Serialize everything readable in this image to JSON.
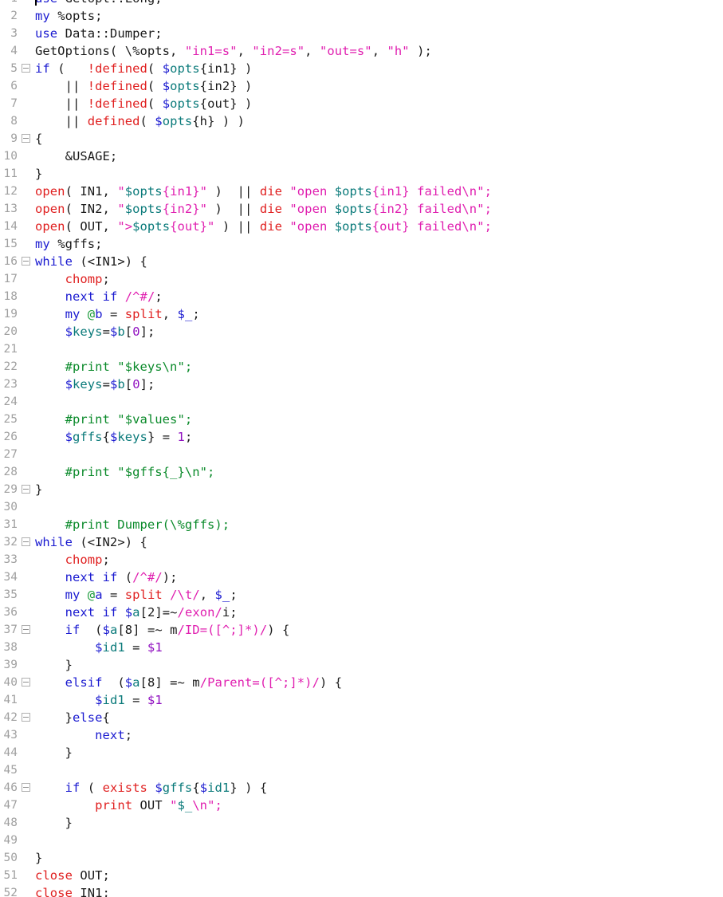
{
  "editor": {
    "language": "perl",
    "gutter_color": "#a0a0a0",
    "background": "#ffffff",
    "foreground": "#1a1a1a",
    "caret_line": 1,
    "caret_column": 1,
    "first_visible_line": 1,
    "last_visible_line": 52,
    "palette": {
      "keyword": "#1a1aD0",
      "function": "#E02020",
      "string": "#E020B0",
      "variable": "#0a7a7a",
      "sigil_scalar": "#1a1aD0",
      "sigil_array": "#1a9a3a",
      "comment": "#0a8a2a",
      "number": "#9010C0",
      "regex": "#E020B0",
      "plain": "#1a1a1a",
      "line_number": "#a0a0a0",
      "fold_marker_border": "#b0b0b0"
    }
  },
  "lines": [
    {
      "n": "1",
      "fold": false,
      "caret": true,
      "tokens": [
        {
          "t": "use",
          "c": "t-kw"
        },
        {
          "t": " Getopt::Long;",
          "c": "t-plain"
        }
      ]
    },
    {
      "n": "2",
      "fold": false,
      "tokens": [
        {
          "t": "my",
          "c": "t-kw"
        },
        {
          "t": " %opts;",
          "c": "t-plain"
        }
      ]
    },
    {
      "n": "3",
      "fold": false,
      "tokens": [
        {
          "t": "use",
          "c": "t-kw"
        },
        {
          "t": " Data::Dumper;",
          "c": "t-plain"
        }
      ]
    },
    {
      "n": "4",
      "fold": false,
      "tokens": [
        {
          "t": "GetOptions( \\%opts, ",
          "c": "t-plain"
        },
        {
          "t": "\"in1=s\"",
          "c": "t-str"
        },
        {
          "t": ", ",
          "c": "t-plain"
        },
        {
          "t": "\"in2=s\"",
          "c": "t-str"
        },
        {
          "t": ", ",
          "c": "t-plain"
        },
        {
          "t": "\"out=s\"",
          "c": "t-str"
        },
        {
          "t": ", ",
          "c": "t-plain"
        },
        {
          "t": "\"h\"",
          "c": "t-str"
        },
        {
          "t": " );",
          "c": "t-plain"
        }
      ]
    },
    {
      "n": "5",
      "fold": true,
      "tokens": [
        {
          "t": "if",
          "c": "t-kw"
        },
        {
          "t": " (   ",
          "c": "t-plain"
        },
        {
          "t": "!defined",
          "c": "t-fn"
        },
        {
          "t": "( ",
          "c": "t-plain"
        },
        {
          "t": "$",
          "c": "t-sigil"
        },
        {
          "t": "opts",
          "c": "t-var"
        },
        {
          "t": "{in1} )",
          "c": "t-plain"
        }
      ]
    },
    {
      "n": "6",
      "fold": false,
      "tokens": [
        {
          "t": "    || ",
          "c": "t-plain"
        },
        {
          "t": "!defined",
          "c": "t-fn"
        },
        {
          "t": "( ",
          "c": "t-plain"
        },
        {
          "t": "$",
          "c": "t-sigil"
        },
        {
          "t": "opts",
          "c": "t-var"
        },
        {
          "t": "{in2} )",
          "c": "t-plain"
        }
      ]
    },
    {
      "n": "7",
      "fold": false,
      "tokens": [
        {
          "t": "    || ",
          "c": "t-plain"
        },
        {
          "t": "!defined",
          "c": "t-fn"
        },
        {
          "t": "( ",
          "c": "t-plain"
        },
        {
          "t": "$",
          "c": "t-sigil"
        },
        {
          "t": "opts",
          "c": "t-var"
        },
        {
          "t": "{out} )",
          "c": "t-plain"
        }
      ]
    },
    {
      "n": "8",
      "fold": false,
      "tokens": [
        {
          "t": "    || ",
          "c": "t-plain"
        },
        {
          "t": "defined",
          "c": "t-fn"
        },
        {
          "t": "( ",
          "c": "t-plain"
        },
        {
          "t": "$",
          "c": "t-sigil"
        },
        {
          "t": "opts",
          "c": "t-var"
        },
        {
          "t": "{h} ) )",
          "c": "t-plain"
        }
      ]
    },
    {
      "n": "9",
      "fold": true,
      "tokens": [
        {
          "t": "{",
          "c": "t-plain"
        }
      ]
    },
    {
      "n": "10",
      "fold": false,
      "tokens": [
        {
          "t": "    &USAGE;",
          "c": "t-plain"
        }
      ]
    },
    {
      "n": "11",
      "fold": false,
      "tokens": [
        {
          "t": "}",
          "c": "t-plain"
        }
      ]
    },
    {
      "n": "12",
      "fold": false,
      "tokens": [
        {
          "t": "open",
          "c": "t-fn"
        },
        {
          "t": "( IN1, ",
          "c": "t-plain"
        },
        {
          "t": "\"",
          "c": "t-str"
        },
        {
          "t": "$opts",
          "c": "t-var"
        },
        {
          "t": "{in1}\"",
          "c": "t-str"
        },
        {
          "t": " )  || ",
          "c": "t-plain"
        },
        {
          "t": "die",
          "c": "t-fn"
        },
        {
          "t": " \"open ",
          "c": "t-str"
        },
        {
          "t": "$opts",
          "c": "t-var"
        },
        {
          "t": "{in1} failed\\n\";",
          "c": "t-str"
        }
      ]
    },
    {
      "n": "13",
      "fold": false,
      "tokens": [
        {
          "t": "open",
          "c": "t-fn"
        },
        {
          "t": "( IN2, ",
          "c": "t-plain"
        },
        {
          "t": "\"",
          "c": "t-str"
        },
        {
          "t": "$opts",
          "c": "t-var"
        },
        {
          "t": "{in2}\"",
          "c": "t-str"
        },
        {
          "t": " )  || ",
          "c": "t-plain"
        },
        {
          "t": "die",
          "c": "t-fn"
        },
        {
          "t": " \"open ",
          "c": "t-str"
        },
        {
          "t": "$opts",
          "c": "t-var"
        },
        {
          "t": "{in2} failed\\n\";",
          "c": "t-str"
        }
      ]
    },
    {
      "n": "14",
      "fold": false,
      "tokens": [
        {
          "t": "open",
          "c": "t-fn"
        },
        {
          "t": "( OUT, ",
          "c": "t-plain"
        },
        {
          "t": "\">",
          "c": "t-str"
        },
        {
          "t": "$opts",
          "c": "t-var"
        },
        {
          "t": "{out}\"",
          "c": "t-str"
        },
        {
          "t": " ) || ",
          "c": "t-plain"
        },
        {
          "t": "die",
          "c": "t-fn"
        },
        {
          "t": " \"open ",
          "c": "t-str"
        },
        {
          "t": "$opts",
          "c": "t-var"
        },
        {
          "t": "{out} failed\\n\";",
          "c": "t-str"
        }
      ]
    },
    {
      "n": "15",
      "fold": false,
      "tokens": [
        {
          "t": "my",
          "c": "t-kw"
        },
        {
          "t": " %gffs;",
          "c": "t-plain"
        }
      ]
    },
    {
      "n": "16",
      "fold": true,
      "tokens": [
        {
          "t": "while",
          "c": "t-kw"
        },
        {
          "t": " (<IN1>) {",
          "c": "t-plain"
        }
      ]
    },
    {
      "n": "17",
      "fold": false,
      "tokens": [
        {
          "t": "    ",
          "c": "t-plain"
        },
        {
          "t": "chomp",
          "c": "t-fn"
        },
        {
          "t": ";",
          "c": "t-plain"
        }
      ]
    },
    {
      "n": "18",
      "fold": false,
      "tokens": [
        {
          "t": "    ",
          "c": "t-plain"
        },
        {
          "t": "next",
          "c": "t-kw"
        },
        {
          "t": " ",
          "c": "t-plain"
        },
        {
          "t": "if",
          "c": "t-kw"
        },
        {
          "t": " ",
          "c": "t-plain"
        },
        {
          "t": "/^#/",
          "c": "t-re"
        },
        {
          "t": ";",
          "c": "t-plain"
        }
      ]
    },
    {
      "n": "19",
      "fold": false,
      "tokens": [
        {
          "t": "    ",
          "c": "t-plain"
        },
        {
          "t": "my",
          "c": "t-kw"
        },
        {
          "t": " ",
          "c": "t-plain"
        },
        {
          "t": "@",
          "c": "t-sigil-a"
        },
        {
          "t": "b",
          "c": "t-kw"
        },
        {
          "t": " = ",
          "c": "t-plain"
        },
        {
          "t": "split",
          "c": "t-fn"
        },
        {
          "t": ", ",
          "c": "t-plain"
        },
        {
          "t": "$_",
          "c": "t-sigil"
        },
        {
          "t": ";",
          "c": "t-plain"
        }
      ]
    },
    {
      "n": "20",
      "fold": false,
      "tokens": [
        {
          "t": "    ",
          "c": "t-plain"
        },
        {
          "t": "$",
          "c": "t-sigil"
        },
        {
          "t": "keys",
          "c": "t-var"
        },
        {
          "t": "=",
          "c": "t-plain"
        },
        {
          "t": "$",
          "c": "t-sigil"
        },
        {
          "t": "b",
          "c": "t-var"
        },
        {
          "t": "[",
          "c": "t-plain"
        },
        {
          "t": "0",
          "c": "t-num"
        },
        {
          "t": "];",
          "c": "t-plain"
        }
      ]
    },
    {
      "n": "21",
      "fold": false,
      "tokens": []
    },
    {
      "n": "22",
      "fold": false,
      "tokens": [
        {
          "t": "    #print \"$keys\\n\";",
          "c": "t-cmt"
        }
      ]
    },
    {
      "n": "23",
      "fold": false,
      "tokens": [
        {
          "t": "    ",
          "c": "t-plain"
        },
        {
          "t": "$",
          "c": "t-sigil"
        },
        {
          "t": "keys",
          "c": "t-var"
        },
        {
          "t": "=",
          "c": "t-plain"
        },
        {
          "t": "$",
          "c": "t-sigil"
        },
        {
          "t": "b",
          "c": "t-var"
        },
        {
          "t": "[",
          "c": "t-plain"
        },
        {
          "t": "0",
          "c": "t-num"
        },
        {
          "t": "];",
          "c": "t-plain"
        }
      ]
    },
    {
      "n": "24",
      "fold": false,
      "tokens": []
    },
    {
      "n": "25",
      "fold": false,
      "tokens": [
        {
          "t": "    #print \"$values\";",
          "c": "t-cmt"
        }
      ]
    },
    {
      "n": "26",
      "fold": false,
      "tokens": [
        {
          "t": "    ",
          "c": "t-plain"
        },
        {
          "t": "$",
          "c": "t-sigil"
        },
        {
          "t": "gffs",
          "c": "t-var"
        },
        {
          "t": "{",
          "c": "t-plain"
        },
        {
          "t": "$",
          "c": "t-sigil"
        },
        {
          "t": "keys",
          "c": "t-var"
        },
        {
          "t": "} = ",
          "c": "t-plain"
        },
        {
          "t": "1",
          "c": "t-num"
        },
        {
          "t": ";",
          "c": "t-plain"
        }
      ]
    },
    {
      "n": "27",
      "fold": false,
      "tokens": []
    },
    {
      "n": "28",
      "fold": false,
      "tokens": [
        {
          "t": "    #print \"$gffs{_}\\n\";",
          "c": "t-cmt"
        }
      ]
    },
    {
      "n": "29",
      "fold": true,
      "tokens": [
        {
          "t": "}",
          "c": "t-plain"
        }
      ]
    },
    {
      "n": "30",
      "fold": false,
      "tokens": []
    },
    {
      "n": "31",
      "fold": false,
      "tokens": [
        {
          "t": "    #print Dumper(\\%gffs);",
          "c": "t-cmt"
        }
      ]
    },
    {
      "n": "32",
      "fold": true,
      "tokens": [
        {
          "t": "while",
          "c": "t-kw"
        },
        {
          "t": " (<IN2>) {",
          "c": "t-plain"
        }
      ]
    },
    {
      "n": "33",
      "fold": false,
      "tokens": [
        {
          "t": "    ",
          "c": "t-plain"
        },
        {
          "t": "chomp",
          "c": "t-fn"
        },
        {
          "t": ";",
          "c": "t-plain"
        }
      ]
    },
    {
      "n": "34",
      "fold": false,
      "tokens": [
        {
          "t": "    ",
          "c": "t-plain"
        },
        {
          "t": "next",
          "c": "t-kw"
        },
        {
          "t": " ",
          "c": "t-plain"
        },
        {
          "t": "if",
          "c": "t-kw"
        },
        {
          "t": " (",
          "c": "t-plain"
        },
        {
          "t": "/^#/",
          "c": "t-re"
        },
        {
          "t": ");",
          "c": "t-plain"
        }
      ]
    },
    {
      "n": "35",
      "fold": false,
      "tokens": [
        {
          "t": "    ",
          "c": "t-plain"
        },
        {
          "t": "my",
          "c": "t-kw"
        },
        {
          "t": " ",
          "c": "t-plain"
        },
        {
          "t": "@",
          "c": "t-sigil-a"
        },
        {
          "t": "a",
          "c": "t-kw"
        },
        {
          "t": " = ",
          "c": "t-plain"
        },
        {
          "t": "split",
          "c": "t-fn"
        },
        {
          "t": " ",
          "c": "t-plain"
        },
        {
          "t": "/\\t/",
          "c": "t-re"
        },
        {
          "t": ", ",
          "c": "t-plain"
        },
        {
          "t": "$_",
          "c": "t-sigil"
        },
        {
          "t": ";",
          "c": "t-plain"
        }
      ]
    },
    {
      "n": "36",
      "fold": false,
      "tokens": [
        {
          "t": "    ",
          "c": "t-plain"
        },
        {
          "t": "next",
          "c": "t-kw"
        },
        {
          "t": " ",
          "c": "t-plain"
        },
        {
          "t": "if",
          "c": "t-kw"
        },
        {
          "t": " ",
          "c": "t-plain"
        },
        {
          "t": "$",
          "c": "t-sigil"
        },
        {
          "t": "a",
          "c": "t-var"
        },
        {
          "t": "[2]=~",
          "c": "t-plain"
        },
        {
          "t": "/exon/",
          "c": "t-re"
        },
        {
          "t": "i;",
          "c": "t-plain"
        }
      ]
    },
    {
      "n": "37",
      "fold": true,
      "tokens": [
        {
          "t": "    ",
          "c": "t-plain"
        },
        {
          "t": "if",
          "c": "t-kw"
        },
        {
          "t": "  (",
          "c": "t-plain"
        },
        {
          "t": "$",
          "c": "t-sigil"
        },
        {
          "t": "a",
          "c": "t-var"
        },
        {
          "t": "[8] =~ m",
          "c": "t-plain"
        },
        {
          "t": "/ID=([^;]*)/",
          "c": "t-re"
        },
        {
          "t": ") {",
          "c": "t-plain"
        }
      ]
    },
    {
      "n": "38",
      "fold": false,
      "tokens": [
        {
          "t": "        ",
          "c": "t-plain"
        },
        {
          "t": "$",
          "c": "t-sigil"
        },
        {
          "t": "id1",
          "c": "t-var"
        },
        {
          "t": " = ",
          "c": "t-plain"
        },
        {
          "t": "$1",
          "c": "t-num"
        }
      ]
    },
    {
      "n": "39",
      "fold": false,
      "tokens": [
        {
          "t": "    }",
          "c": "t-plain"
        }
      ]
    },
    {
      "n": "40",
      "fold": true,
      "tokens": [
        {
          "t": "    ",
          "c": "t-plain"
        },
        {
          "t": "elsif",
          "c": "t-kw"
        },
        {
          "t": "  (",
          "c": "t-plain"
        },
        {
          "t": "$",
          "c": "t-sigil"
        },
        {
          "t": "a",
          "c": "t-var"
        },
        {
          "t": "[8] =~ m",
          "c": "t-plain"
        },
        {
          "t": "/Parent=([^;]*)/",
          "c": "t-re"
        },
        {
          "t": ") {",
          "c": "t-plain"
        }
      ]
    },
    {
      "n": "41",
      "fold": false,
      "tokens": [
        {
          "t": "        ",
          "c": "t-plain"
        },
        {
          "t": "$",
          "c": "t-sigil"
        },
        {
          "t": "id1",
          "c": "t-var"
        },
        {
          "t": " = ",
          "c": "t-plain"
        },
        {
          "t": "$1",
          "c": "t-num"
        }
      ]
    },
    {
      "n": "42",
      "fold": true,
      "tokens": [
        {
          "t": "    }",
          "c": "t-plain"
        },
        {
          "t": "else",
          "c": "t-kw"
        },
        {
          "t": "{",
          "c": "t-plain"
        }
      ]
    },
    {
      "n": "43",
      "fold": false,
      "tokens": [
        {
          "t": "        ",
          "c": "t-plain"
        },
        {
          "t": "next",
          "c": "t-kw"
        },
        {
          "t": ";",
          "c": "t-plain"
        }
      ]
    },
    {
      "n": "44",
      "fold": false,
      "tokens": [
        {
          "t": "    }",
          "c": "t-plain"
        }
      ]
    },
    {
      "n": "45",
      "fold": false,
      "tokens": []
    },
    {
      "n": "46",
      "fold": true,
      "tokens": [
        {
          "t": "    ",
          "c": "t-plain"
        },
        {
          "t": "if",
          "c": "t-kw"
        },
        {
          "t": " ( ",
          "c": "t-plain"
        },
        {
          "t": "exists",
          "c": "t-fn"
        },
        {
          "t": " ",
          "c": "t-plain"
        },
        {
          "t": "$",
          "c": "t-sigil"
        },
        {
          "t": "gffs",
          "c": "t-var"
        },
        {
          "t": "{",
          "c": "t-plain"
        },
        {
          "t": "$",
          "c": "t-sigil"
        },
        {
          "t": "id1",
          "c": "t-var"
        },
        {
          "t": "} ) {",
          "c": "t-plain"
        }
      ]
    },
    {
      "n": "47",
      "fold": false,
      "tokens": [
        {
          "t": "        ",
          "c": "t-plain"
        },
        {
          "t": "print",
          "c": "t-fn"
        },
        {
          "t": " OUT ",
          "c": "t-plain"
        },
        {
          "t": "\"",
          "c": "t-str"
        },
        {
          "t": "$_",
          "c": "t-var"
        },
        {
          "t": "\\n\";",
          "c": "t-str"
        }
      ]
    },
    {
      "n": "48",
      "fold": false,
      "tokens": [
        {
          "t": "    }",
          "c": "t-plain"
        }
      ]
    },
    {
      "n": "49",
      "fold": false,
      "tokens": []
    },
    {
      "n": "50",
      "fold": false,
      "tokens": [
        {
          "t": "}",
          "c": "t-plain"
        }
      ]
    },
    {
      "n": "51",
      "fold": false,
      "tokens": [
        {
          "t": "close",
          "c": "t-fn"
        },
        {
          "t": " OUT;",
          "c": "t-plain"
        }
      ]
    },
    {
      "n": "52",
      "fold": false,
      "tokens": [
        {
          "t": "close",
          "c": "t-fn"
        },
        {
          "t": " IN1;",
          "c": "t-plain"
        }
      ]
    }
  ]
}
